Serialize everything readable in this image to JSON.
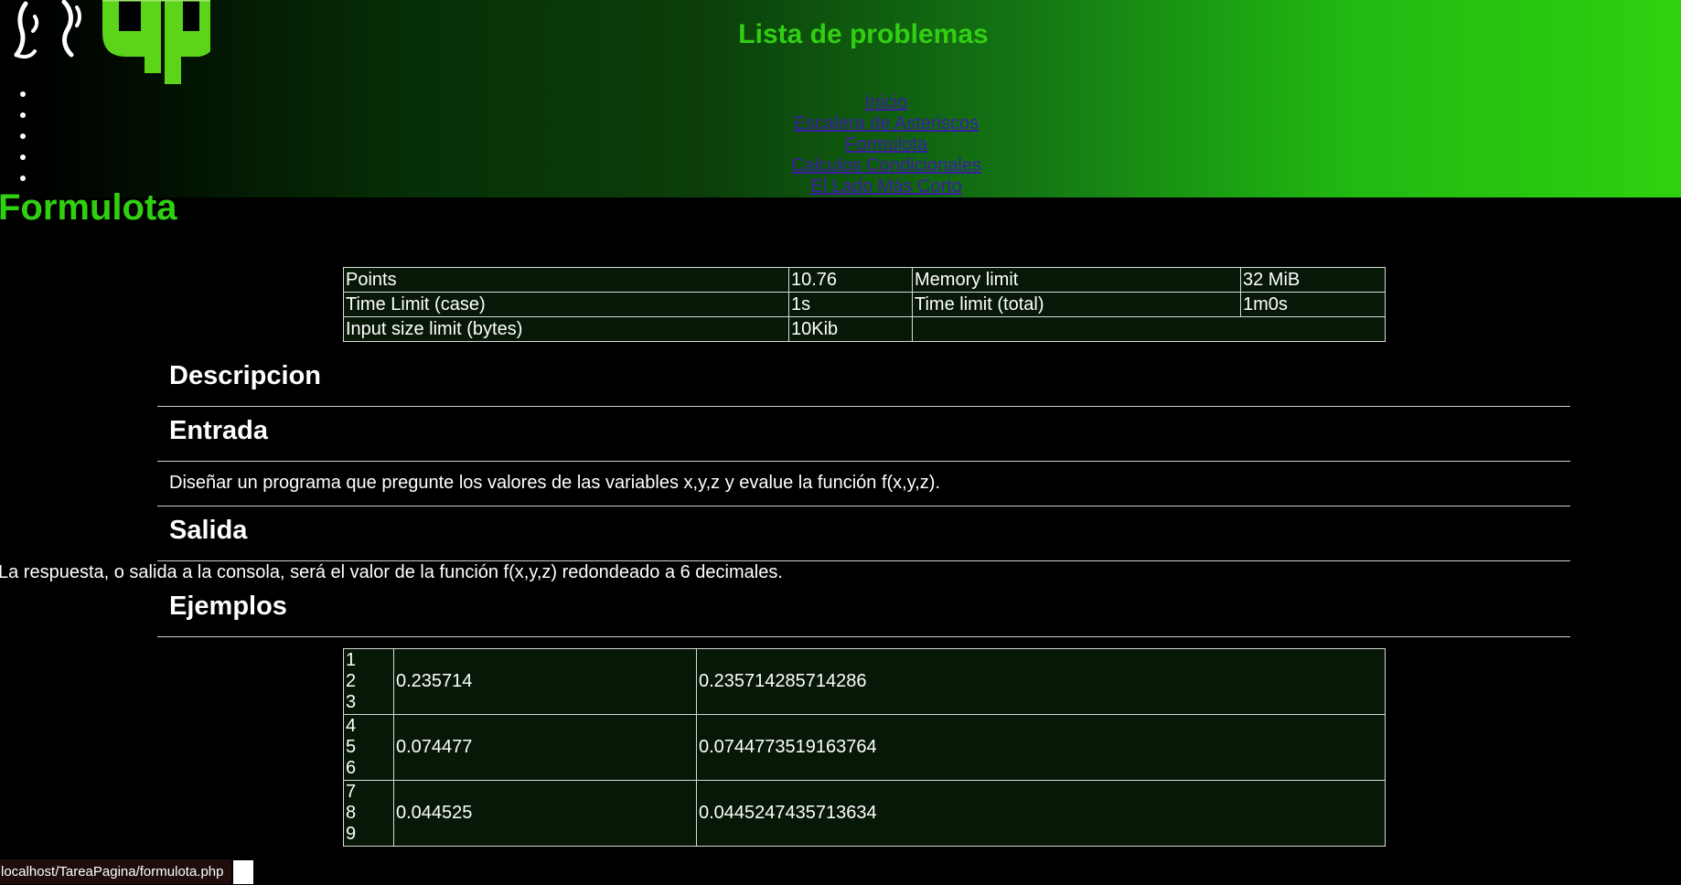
{
  "header": {
    "title": "Lista de problemas",
    "logo_icon": "green-logo-icon",
    "nav": [
      {
        "label": "Inicio"
      },
      {
        "label": "Escalera de Asteriscos"
      },
      {
        "label": "Formulota"
      },
      {
        "label": "Calculos Condicionales"
      },
      {
        "label": "El Lado Más Corto"
      }
    ]
  },
  "page": {
    "heading": "Formulota"
  },
  "info": {
    "rows": [
      {
        "k1": "Points",
        "v1": "10.76",
        "k2": "Memory limit",
        "v2": "32 MiB"
      },
      {
        "k1": "Time Limit (case)",
        "v1": "1s",
        "k2": "Time limit (total)",
        "v2": "1m0s"
      },
      {
        "k1": "Input size limit (bytes)",
        "v1": "10Kib",
        "k2": "",
        "v2": ""
      }
    ]
  },
  "sections": {
    "descripcion": "Descripcion",
    "entrada": "Entrada",
    "entrada_text": "Diseñar un programa que pregunte los valores de las variables x,y,z y evalue la función f(x,y,z).",
    "salida": "Salida",
    "salida_text": "La respuesta, o salida a la consola, será el valor de la función f(x,y,z) redondeado a 6 decimales.",
    "ejemplos": "Ejemplos"
  },
  "examples": [
    {
      "in1": "1",
      "in2": "2",
      "in3": "3",
      "out": "0.235714",
      "exact": "0.235714285714286"
    },
    {
      "in1": "4",
      "in2": "5",
      "in3": "6",
      "out": "0.074477",
      "exact": "0.0744773519163764"
    },
    {
      "in1": "7",
      "in2": "8",
      "in3": "9",
      "out": "0.044525",
      "exact": "0.0445247435713634"
    }
  ],
  "status": {
    "url": "localhost/TareaPagina/formulota.php"
  },
  "colors": {
    "accent_green": "#31cf12",
    "link_color": "#3e1ca8",
    "table_bg": "#071807"
  }
}
